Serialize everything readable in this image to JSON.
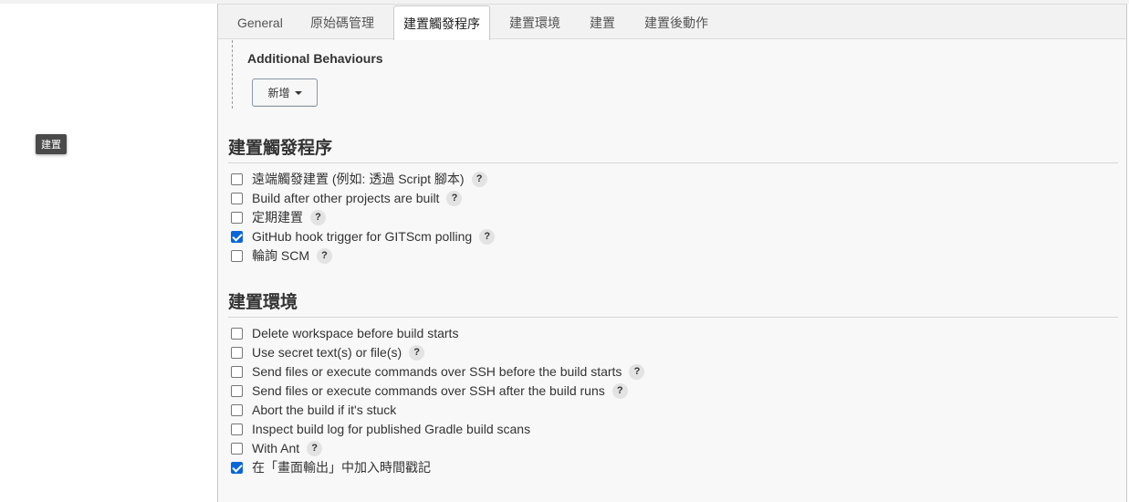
{
  "tooltip": "建置",
  "tabs": [
    {
      "label": "General"
    },
    {
      "label": "原始碼管理"
    },
    {
      "label": "建置觸發程序"
    },
    {
      "label": "建置環境"
    },
    {
      "label": "建置"
    },
    {
      "label": "建置後動作"
    }
  ],
  "active_tab": "建置觸發程序",
  "additional_behaviours": {
    "title": "Additional Behaviours",
    "add_button": "新增"
  },
  "help_glyph": "?",
  "triggers": {
    "title": "建置觸發程序",
    "items": [
      {
        "label": "遠端觸發建置 (例如: 透過 Script 腳本)",
        "checked": false,
        "help": true
      },
      {
        "label": "Build after other projects are built",
        "checked": false,
        "help": true
      },
      {
        "label": "定期建置",
        "checked": false,
        "help": true
      },
      {
        "label": "GitHub hook trigger for GITScm polling",
        "checked": true,
        "help": true
      },
      {
        "label": "輪詢 SCM",
        "checked": false,
        "help": true
      }
    ]
  },
  "environment": {
    "title": "建置環境",
    "items": [
      {
        "label": "Delete workspace before build starts",
        "checked": false,
        "help": false
      },
      {
        "label": "Use secret text(s) or file(s)",
        "checked": false,
        "help": true
      },
      {
        "label": "Send files or execute commands over SSH before the build starts",
        "checked": false,
        "help": true
      },
      {
        "label": "Send files or execute commands over SSH after the build runs",
        "checked": false,
        "help": true
      },
      {
        "label": "Abort the build if it's stuck",
        "checked": false,
        "help": false
      },
      {
        "label": "Inspect build log for published Gradle build scans",
        "checked": false,
        "help": false
      },
      {
        "label": "With Ant",
        "checked": false,
        "help": true
      },
      {
        "label": "在「畫面輸出」中加入時間戳記",
        "checked": true,
        "help": false
      }
    ]
  },
  "colors": {
    "accent": "#0a66d8",
    "tooltip_bg": "#4a4a4a"
  }
}
